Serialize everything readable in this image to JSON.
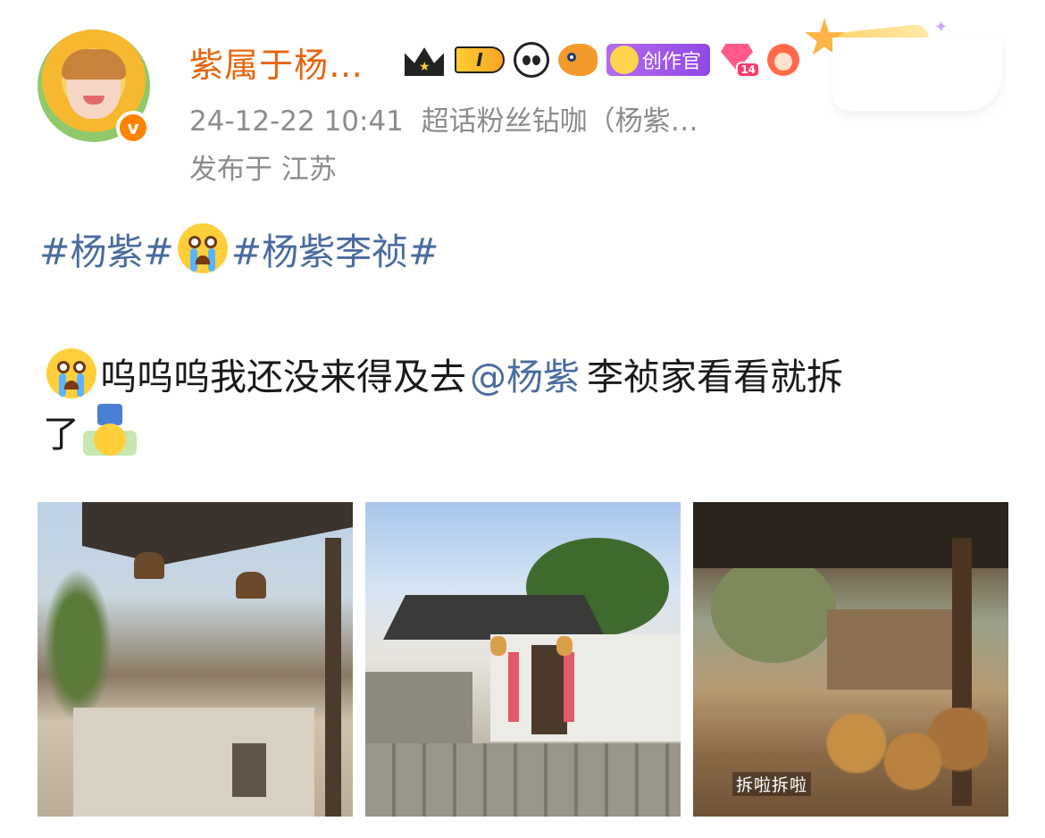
{
  "post": {
    "author": {
      "name": "紫属于杨…",
      "level_badge": "I",
      "creator_badge": "创作官",
      "heart_badge": "14"
    },
    "timestamp": "24-12-22 10:41",
    "source": "超话粉丝钻咖（杨紫…",
    "location": "发布于 江苏",
    "hashtags": [
      "#杨紫#",
      "#杨紫李祯#"
    ],
    "text_before_mention": "呜呜呜我还没来得及去",
    "mention": "@杨紫",
    "text_after_mention": "李祯家看看就拆",
    "text_line2": "了",
    "photos": [
      {
        "alt": "photo-1"
      },
      {
        "alt": "photo-2"
      },
      {
        "alt": "photo-3",
        "caption": "拆啦拆啦"
      }
    ]
  },
  "colors": {
    "name": "#e8650f",
    "meta": "#8c8c8c",
    "link": "#4a6b9f",
    "creator_badge": "#9b57ea"
  },
  "icons": [
    "verified-icon",
    "crown-icon",
    "panda-icon",
    "fish-icon",
    "creator-icon",
    "diamond-heart-icon",
    "girl-icon",
    "crying-emoji-icon",
    "upside-down-emoji-icon"
  ]
}
